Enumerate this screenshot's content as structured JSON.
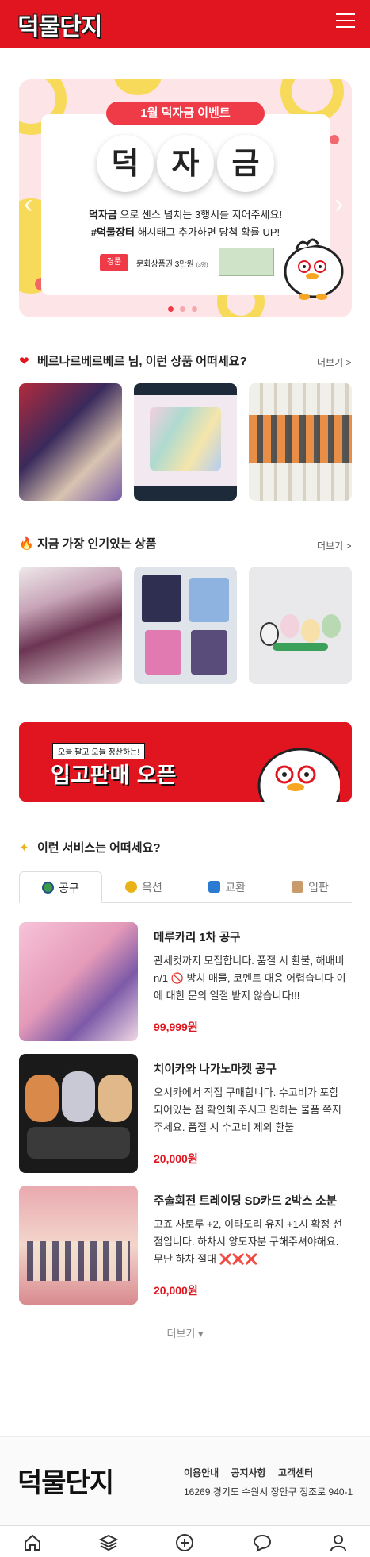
{
  "header": {
    "logo": "덕물단지"
  },
  "banner": {
    "event_title": "1월 덕자금 이벤트",
    "big_chars": [
      "덕",
      "자",
      "금"
    ],
    "line1_bold": "덕자금",
    "line1_rest": " 으로 센스 넘치는 3행시를 지어주세요!",
    "line2_bold": "#덕물장터",
    "line2_rest": " 해시태그 추가하면 당첨 확률 UP!",
    "prize_tag": "경품",
    "prize_text": "문화상품권 3만원",
    "prize_sub": "(3명)"
  },
  "section_recommend": {
    "title": "베르나르베르베르 님, 이런 상품 어떠세요?",
    "more": "더보기 >",
    "icon": "heart-icon"
  },
  "section_popular": {
    "title": "지금 가장 인기있는 상품",
    "more": "더보기 >",
    "icon": "fire-icon"
  },
  "promo": {
    "small": "오늘 팔고 오늘 정산하는!",
    "big": "입고판매 오픈"
  },
  "section_services": {
    "title": "이런 서비스는 어떠세요?",
    "icon": "sparkle-icon"
  },
  "tabs": [
    {
      "label": "공구",
      "icon": "globe-icon"
    },
    {
      "label": "옥션",
      "icon": "money-bag-icon"
    },
    {
      "label": "교환",
      "icon": "exchange-icon"
    },
    {
      "label": "입판",
      "icon": "box-icon"
    }
  ],
  "items": [
    {
      "title": "메루카리 1차 공구",
      "desc": "관세컷까지 모집합니다. 품절 시 환불, 해배비 n/1 🚫 방치 매물, 코멘트 대응 어렵습니다 이에 대한 문의 일절 받지 않습니다!!!",
      "price": "99,999원"
    },
    {
      "title": "치이카와 나가노마켓 공구",
      "desc": "오시카에서 직접 구매합니다. 수고비가 포함되어있는 점 확인해 주시고 원하는 물품 쪽지주세요. 품절 시 수고비 제외 환불",
      "price": "20,000원"
    },
    {
      "title": "주술회전 트레이딩 SD카드 2박스 소분",
      "desc": "고죠 사토루 +2, 이타도리 유지 +1시 확정 선점입니다. 하차시 양도자분 구해주셔야해요. 무단 하차 절대 ❌❌❌",
      "price": "20,000원"
    }
  ],
  "load_more": "더보기 ▾",
  "footer": {
    "logo": "덕물단지",
    "links": [
      "이용안내",
      "공지사항",
      "고객센터"
    ],
    "address": "16269 경기도 수원시 장안구 정조로 940-1"
  },
  "tabbar": [
    "home-icon",
    "layers-icon",
    "add-icon",
    "chat-icon",
    "profile-icon"
  ]
}
